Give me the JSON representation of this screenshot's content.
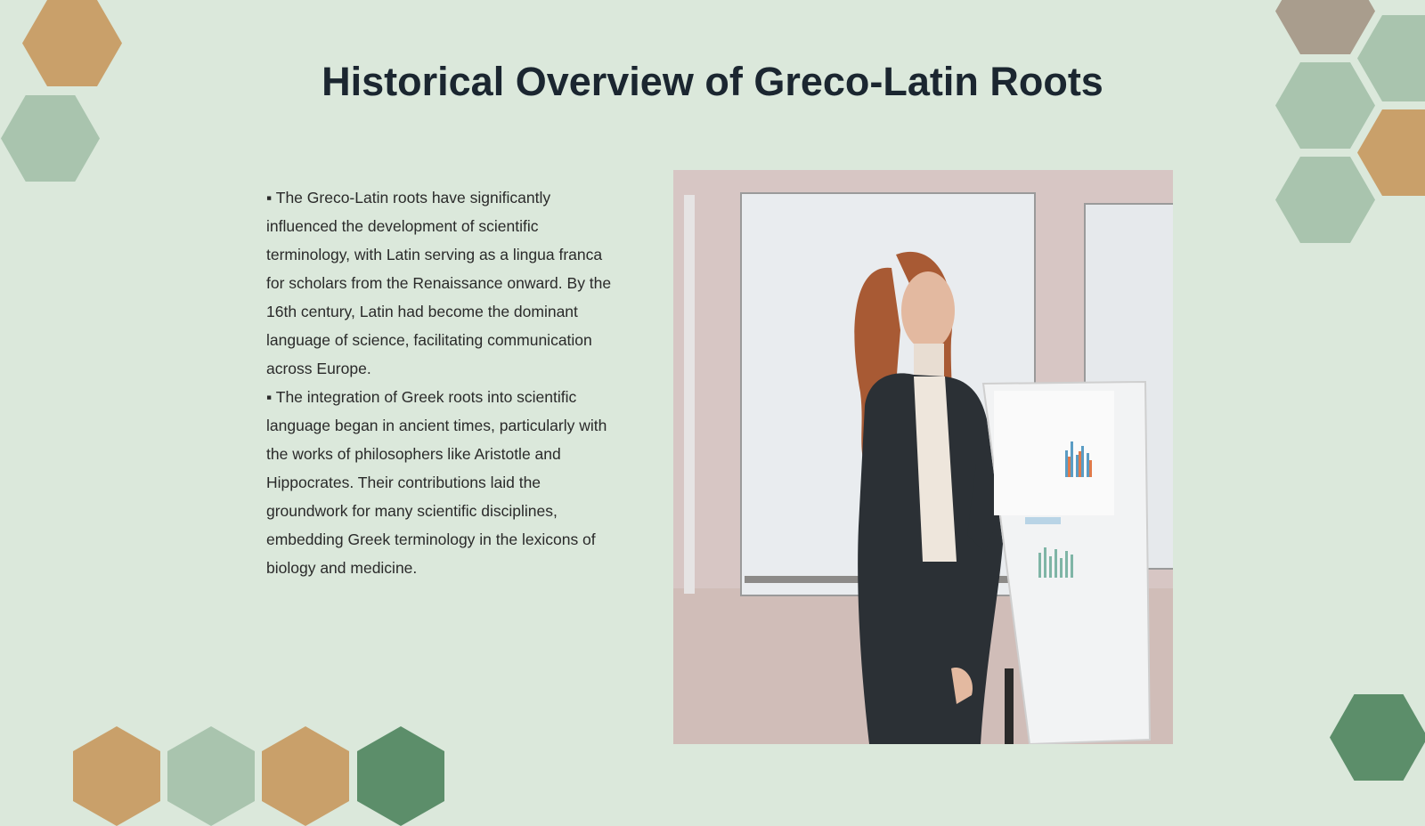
{
  "slide": {
    "title": "Historical Overview of Greco-Latin Roots",
    "bullets": [
      "▪ The Greco-Latin roots have significantly influenced the development of scientific terminology, with Latin serving as a lingua franca for scholars from the Renaissance onward. By the 16th century, Latin had become the dominant language of science, facilitating communication across Europe.",
      "▪ The integration of Greek roots into scientific language began in ancient times, particularly with the works of philosophers like Aristotle and Hippocrates. Their contributions laid the groundwork for many scientific disciplines, embedding Greek terminology in the lexicons of biology and medicine."
    ]
  },
  "image": {
    "icon": "presenter-photo"
  },
  "colors": {
    "background": "#dbe8db",
    "hex_tan": "#c9a06a",
    "hex_sage": "#a9c4ae",
    "hex_green": "#5c8e6a",
    "hex_taupe": "#a99d8d",
    "title": "#1b2630"
  }
}
